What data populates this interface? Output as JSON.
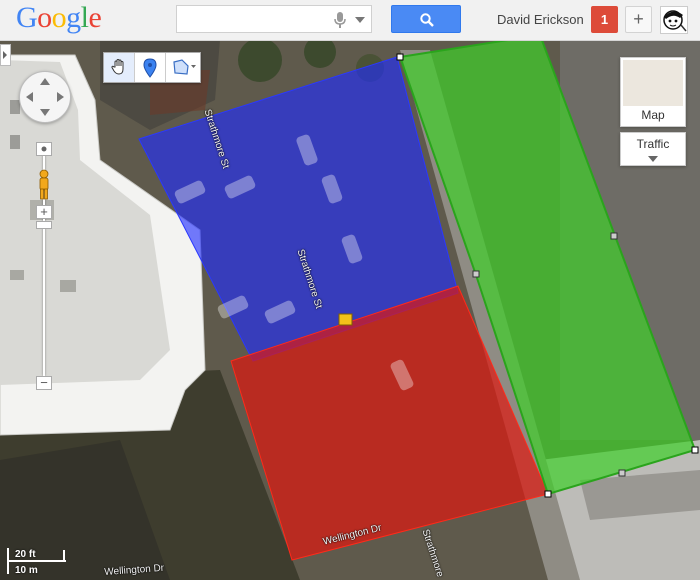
{
  "header": {
    "logo_letters": [
      {
        "ch": "G",
        "color": "#4285f4"
      },
      {
        "ch": "o",
        "color": "#ea4335"
      },
      {
        "ch": "o",
        "color": "#fbbc05"
      },
      {
        "ch": "g",
        "color": "#4285f4"
      },
      {
        "ch": "l",
        "color": "#34a853"
      },
      {
        "ch": "e",
        "color": "#ea4335"
      }
    ],
    "search_value": "",
    "search_placeholder": "",
    "search_icon": "magnifier-icon",
    "mic_icon": "microphone-icon",
    "user_name": "David Erickson",
    "notification_count": "1",
    "share_label": "+",
    "accent_blue": "#4a8af4",
    "badge_red": "#dd4b39"
  },
  "map": {
    "view_type": "satellite",
    "controls": {
      "map_type_label": "Map",
      "traffic_label": "Traffic",
      "tools": [
        "hand-pan-icon",
        "placemark-icon",
        "polygon-icon"
      ],
      "zoom_in": "+",
      "zoom_out": "−"
    },
    "street_labels": {
      "strathmore_1": "Strathmore St",
      "strathmore_2": "Strathmore St",
      "strathmore_3": "Strathmore",
      "wellington_1": "Wellington Dr",
      "wellington_2": "Wellington Dr"
    },
    "scale": {
      "feet": "20 ft",
      "meters": "10 m"
    },
    "polygons": [
      {
        "name": "blue-area",
        "color": "#1f2cff"
      },
      {
        "name": "red-area",
        "color": "#e0170f"
      },
      {
        "name": "green-area",
        "color": "#3ed02a"
      }
    ]
  }
}
